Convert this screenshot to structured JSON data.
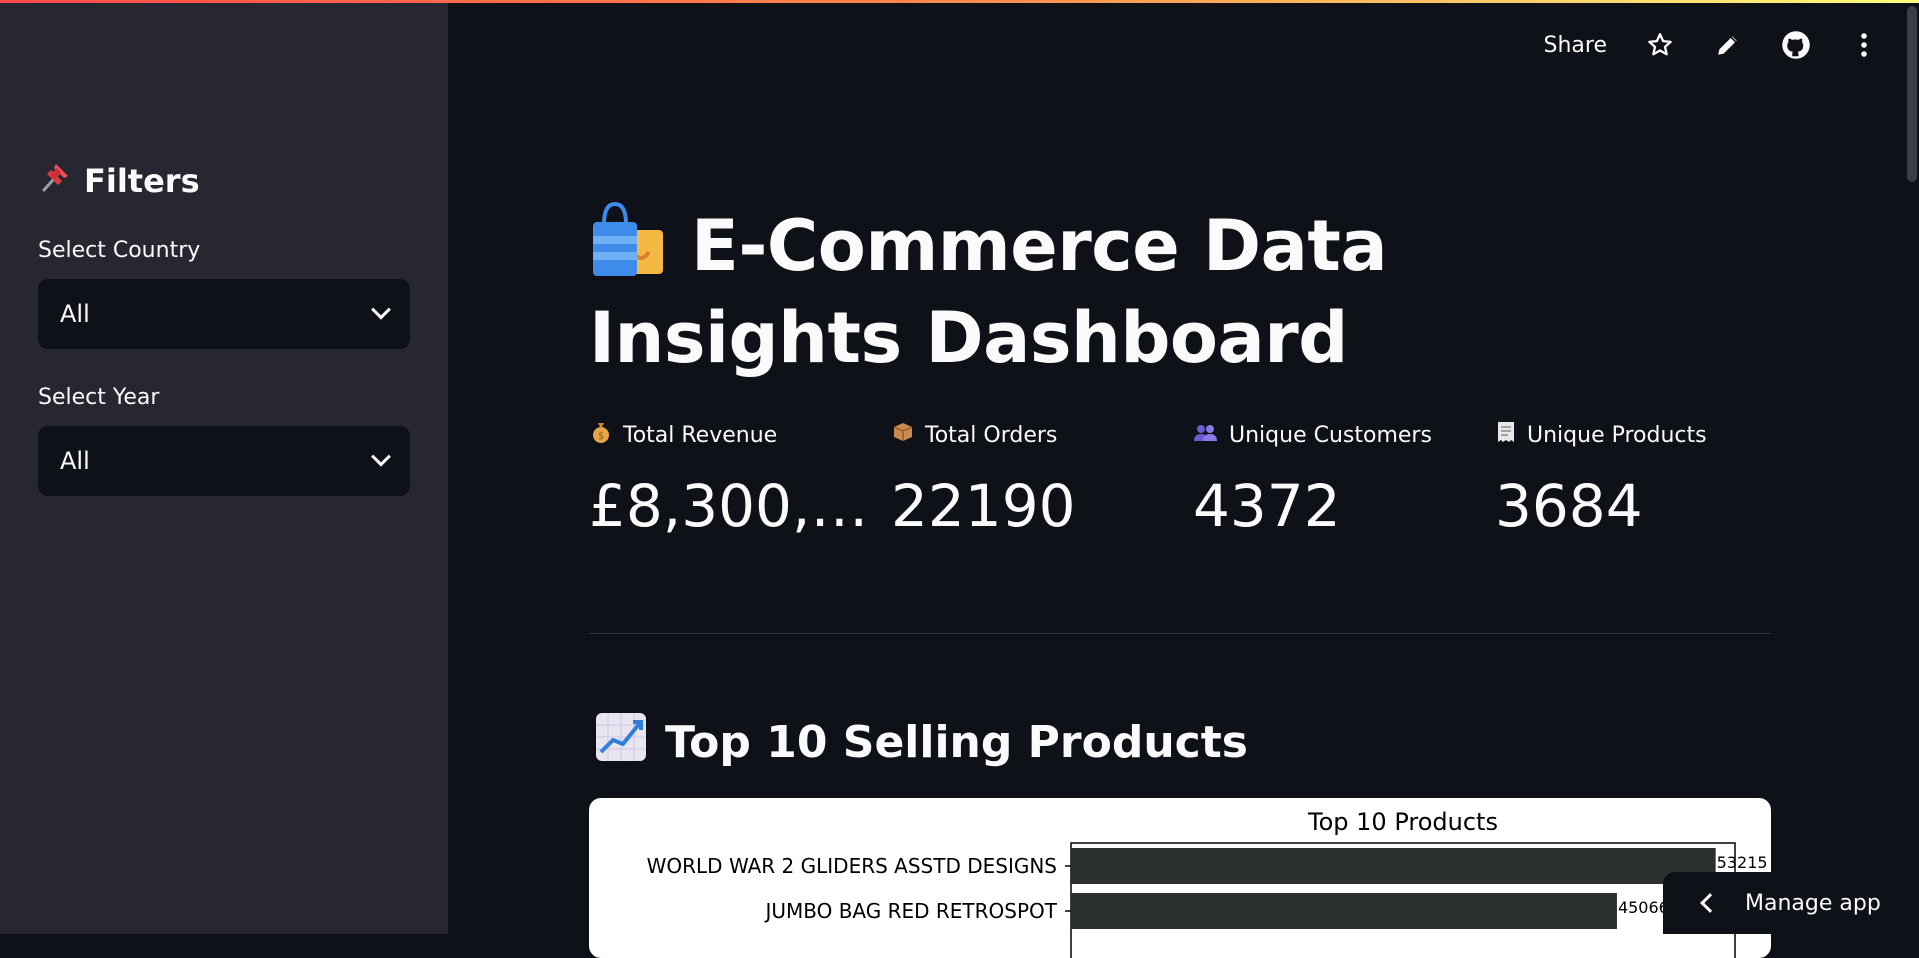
{
  "sidebar": {
    "title": "Filters",
    "pin_icon": "pushpin-icon",
    "country_label": "Select Country",
    "country_value": "All",
    "year_label": "Select Year",
    "year_value": "All"
  },
  "header": {
    "share_label": "Share",
    "icons": [
      "star-icon",
      "pencil-icon",
      "github-icon",
      "kebab-menu-icon"
    ]
  },
  "main": {
    "title": "E-Commerce Data Insights Dashboard",
    "title_icon": "shopping-bags-icon",
    "metrics": [
      {
        "label": "Total Revenue",
        "value": "£8,300,…",
        "icon": "money-bag-icon"
      },
      {
        "label": "Total Orders",
        "value": "22190",
        "icon": "package-icon"
      },
      {
        "label": "Unique Customers",
        "value": "4372",
        "icon": "people-icon"
      },
      {
        "label": "Unique Products",
        "value": "3684",
        "icon": "receipt-icon"
      }
    ],
    "section_title": "Top 10 Selling Products",
    "section_icon": "chart-increasing-icon"
  },
  "manage_app_label": "Manage app",
  "chart_data": {
    "type": "bar",
    "orientation": "horizontal",
    "title": "Top 10 Products",
    "categories": [
      "WORLD WAR 2 GLIDERS ASSTD DESIGNS",
      "JUMBO BAG RED RETROSPOT"
    ],
    "values": [
      53215,
      45066
    ],
    "value_labels": [
      "53215",
      "45066"
    ],
    "bar_color": "#2b2f2e",
    "background": "#ffffff"
  },
  "colors": {
    "app_bg": "#0e1117",
    "sidebar_bg": "#262730",
    "text": "#fafafa"
  }
}
